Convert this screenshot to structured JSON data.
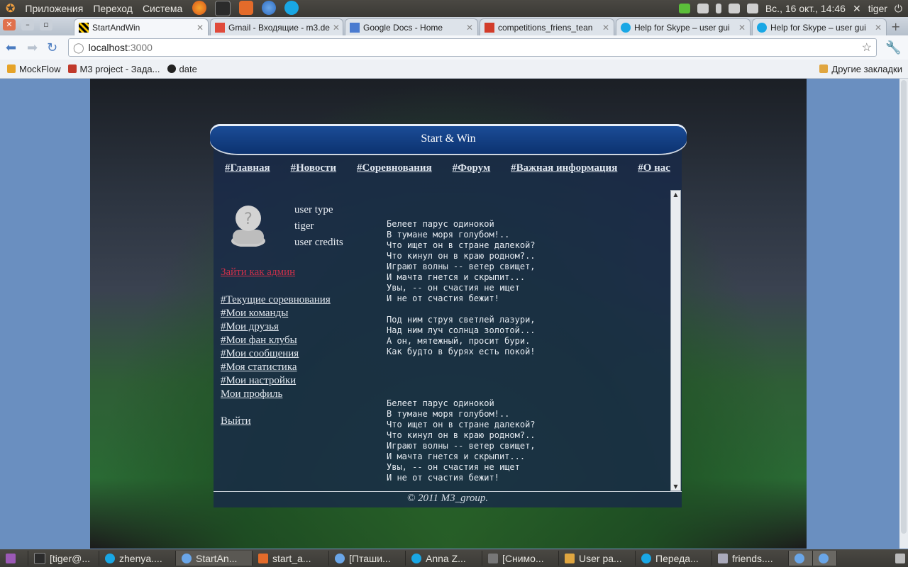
{
  "os_panel": {
    "menus": [
      "Приложения",
      "Переход",
      "Система"
    ],
    "datetime": "Вс., 16 окт., 14:46",
    "user": "tiger"
  },
  "browser": {
    "tabs": [
      {
        "label": "StartAndWin",
        "active": true
      },
      {
        "label": "Gmail - Входящие - m3.de"
      },
      {
        "label": "Google Docs - Home"
      },
      {
        "label": "competitions_friens_tean"
      },
      {
        "label": "Help for Skype – user gui"
      },
      {
        "label": "Help for Skype – user gui"
      }
    ],
    "address_host": "localhost",
    "address_port": ":3000",
    "bookmarks": [
      "MockFlow",
      "M3 project - Зада...",
      "date"
    ],
    "other_bookmarks": "Другие закладки"
  },
  "site": {
    "title": "Start & Win",
    "nav": [
      "#Главная",
      "#Новости",
      "#Соревнования",
      "#Форум",
      "#Важная информация",
      "#О нас"
    ],
    "user_type": "user type",
    "username": "tiger",
    "user_credits": "user credits",
    "admin_link": "Зайти как админ",
    "menu": [
      "#Текущие соревнования",
      "#Мои команды",
      "#Мои друзья",
      "#Мои фан клубы",
      "#Мои сообщения",
      "#Моя статистика",
      "#Мои настройки",
      "Мои профиль"
    ],
    "logout": "Выйти",
    "poem": "Белеет парус одинокой\nВ тумане моря голубом!..\nЧто ищет он в стране далекой?\nЧто кинул он в краю родном?..\nИграют волны -- ветер свищет,\nИ мачта гнется и скрыпит...\nУвы, -- он счастия не ищет\nИ не от счастия бежит!\n\nПод ним струя светлей лазури,\nНад ним луч солнца золотой...\nА он, мятежный, просит бури.\nКак будто в бурях есть покой!",
    "footer": "© 2011 M3_group."
  },
  "taskbar": [
    "[tiger@...",
    "zhenya....",
    "StartAn...",
    "start_a...",
    "[Пташи...",
    "Anna Z...",
    "[Снимо...",
    "User pa...",
    "Переда...",
    "friends...."
  ]
}
